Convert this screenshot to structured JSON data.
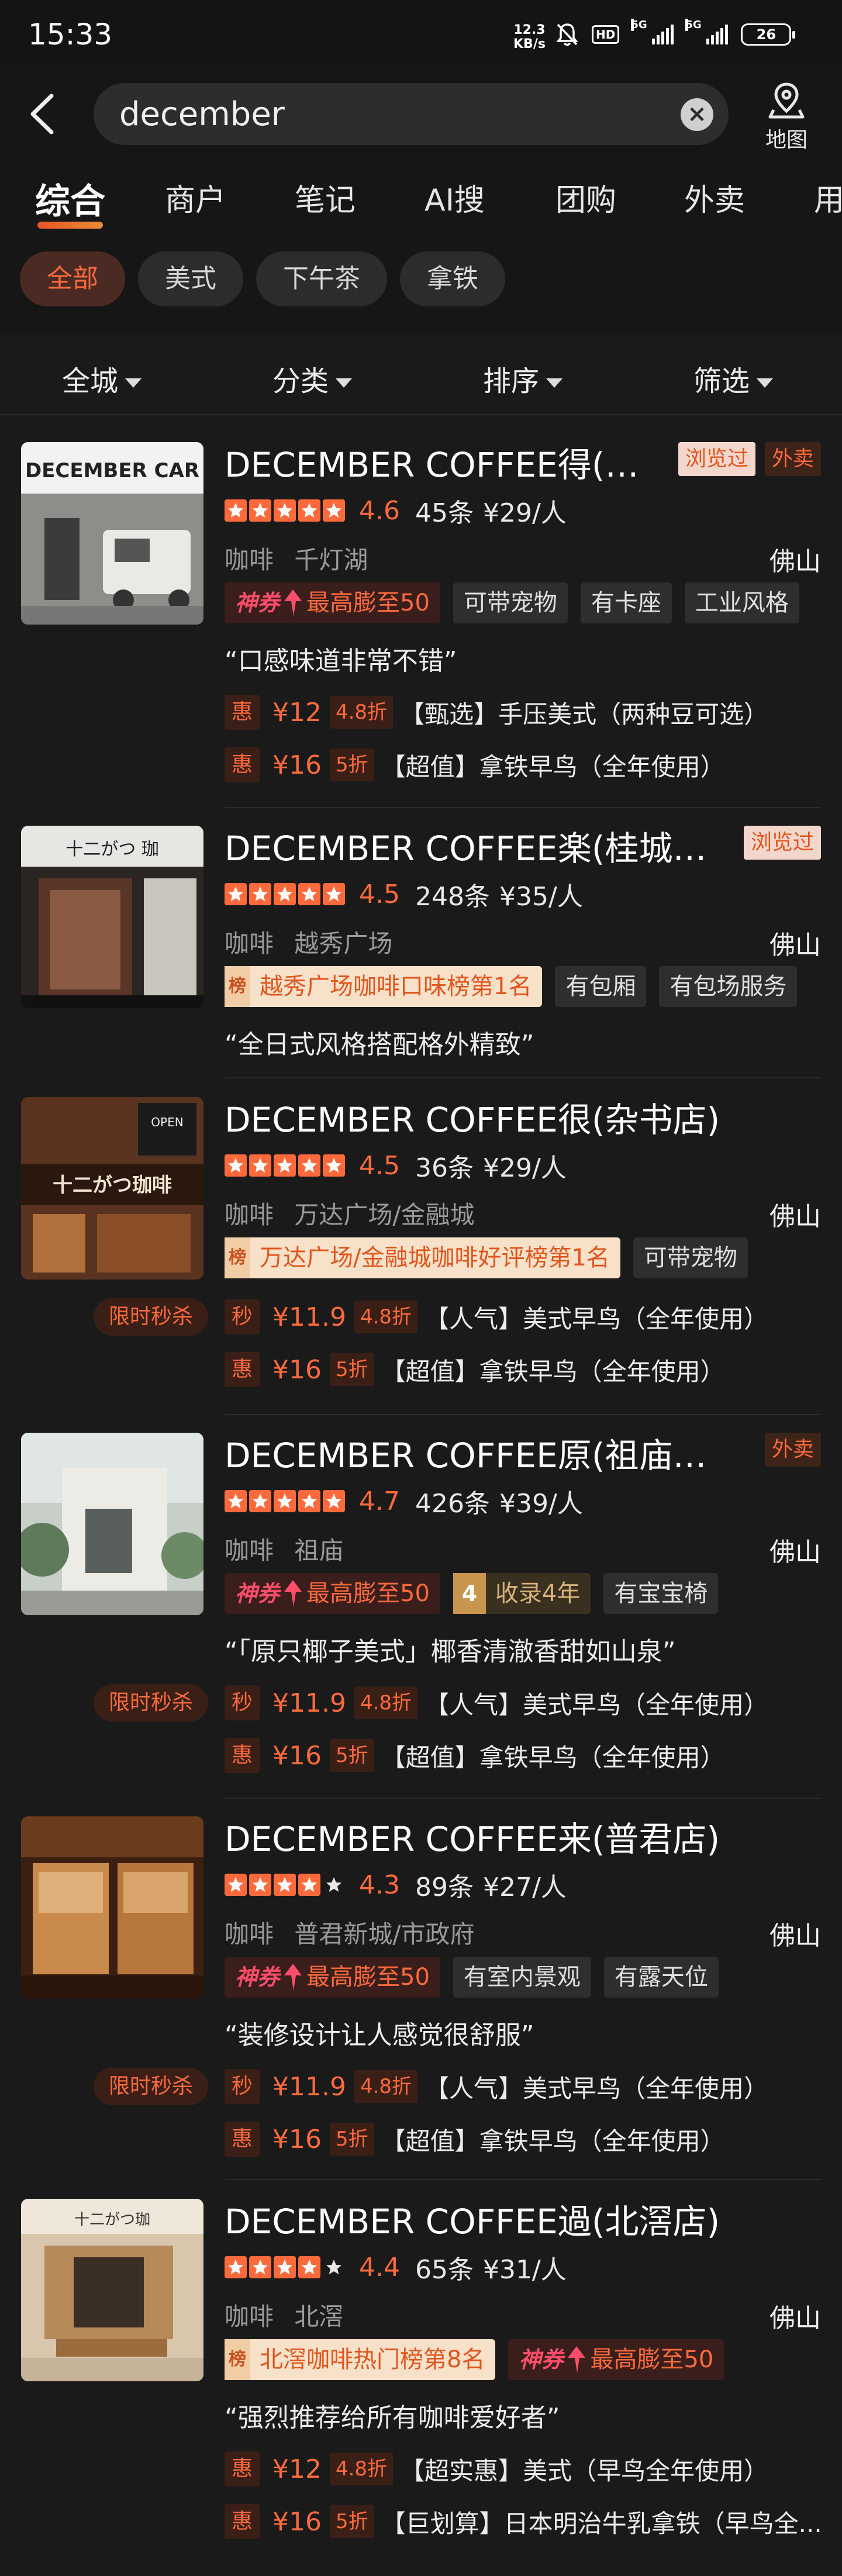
{
  "status": {
    "time": "15:33",
    "speed_value": "12.3",
    "speed_unit": "KB/s",
    "hd": "HD",
    "net1": "5G",
    "net2": "5G",
    "battery": "26"
  },
  "search": {
    "query": "december",
    "map_label": "地图"
  },
  "tabs": [
    "综合",
    "商户",
    "笔记",
    "AI搜",
    "团购",
    "外卖",
    "用"
  ],
  "chips": [
    "全部",
    "美式",
    "下午茶",
    "拿铁"
  ],
  "filters": [
    "全城",
    "分类",
    "排序",
    "筛选"
  ],
  "flash_sale_label": "限时秒杀",
  "stores": [
    {
      "title": "DECEMBER COFFEE得(手...",
      "seen": "浏览过",
      "waimai": "外卖",
      "score": "4.6",
      "reviews": "45条",
      "price": "¥29/人",
      "category": "咖啡",
      "area": "千灯湖",
      "city": "佛山",
      "tags": [
        {
          "type": "pick",
          "label": "神券",
          "text": "最高膨至50"
        },
        {
          "type": "plain",
          "text": "可带宠物"
        },
        {
          "type": "plain",
          "text": "有卡座"
        },
        {
          "type": "plain",
          "text": "工业风格"
        }
      ],
      "quote": "“口感味道非常不错”",
      "deals": [
        {
          "tag": "惠",
          "price": "¥12",
          "disc": "4.8折",
          "name": "【甄选】手压美式（两种豆可选）"
        },
        {
          "tag": "惠",
          "price": "¥16",
          "disc": "5折",
          "name": "【超值】拿铁早鸟（全年使用）"
        }
      ]
    },
    {
      "title": "DECEMBER COFFEE楽(桂城桂...",
      "seen": "浏览过",
      "score": "4.5",
      "reviews": "248条",
      "price": "¥35/人",
      "category": "咖啡",
      "area": "越秀广场",
      "city": "佛山",
      "tags": [
        {
          "type": "rank",
          "icon": "榜",
          "text": "越秀广场咖啡口味榜第1名"
        },
        {
          "type": "plain",
          "text": "有包厢"
        },
        {
          "type": "plain",
          "text": "有包场服务"
        }
      ],
      "quote": "“全日式风格搭配格外精致”"
    },
    {
      "title": "DECEMBER COFFEE很(杂书店)",
      "score": "4.5",
      "reviews": "36条",
      "price": "¥29/人",
      "category": "咖啡",
      "area": "万达广场/金融城",
      "city": "佛山",
      "tags": [
        {
          "type": "rank",
          "icon": "榜",
          "text": "万达广场/金融城咖啡好评榜第1名"
        },
        {
          "type": "plain",
          "text": "可带宠物"
        }
      ],
      "deals": [
        {
          "tag": "秒",
          "price": "¥11.9",
          "disc": "4.8折",
          "name": "【人气】美式早鸟（全年使用）"
        },
        {
          "tag": "惠",
          "price": "¥16",
          "disc": "5折",
          "name": "【超值】拿铁早鸟（全年使用）"
        }
      ]
    },
    {
      "title": "DECEMBER COFFEE原(祖庙店)",
      "waimai": "外卖",
      "score": "4.7",
      "reviews": "426条",
      "price": "¥39/人",
      "category": "咖啡",
      "area": "祖庙",
      "city": "佛山",
      "tags": [
        {
          "type": "pick",
          "label": "神券",
          "text": "最高膨至50"
        },
        {
          "type": "years",
          "num": "4",
          "text": "收录4年"
        },
        {
          "type": "plain",
          "text": "有宝宝椅"
        }
      ],
      "quote": "“「原只椰子美式」椰香清澈香甜如山泉”",
      "deals": [
        {
          "tag": "秒",
          "price": "¥11.9",
          "disc": "4.8折",
          "name": "【人气】美式早鸟（全年使用）"
        },
        {
          "tag": "惠",
          "price": "¥16",
          "disc": "5折",
          "name": "【超值】拿铁早鸟（全年使用）"
        }
      ]
    },
    {
      "title": "DECEMBER COFFEE来(普君店)",
      "score": "4.3",
      "reviews": "89条",
      "price": "¥27/人",
      "category": "咖啡",
      "area": "普君新城/市政府",
      "city": "佛山",
      "tags": [
        {
          "type": "pick",
          "label": "神券",
          "text": "最高膨至50"
        },
        {
          "type": "plain",
          "text": "有室内景观"
        },
        {
          "type": "plain",
          "text": "有露天位"
        }
      ],
      "quote": "“装修设计让人感觉很舒服”",
      "deals": [
        {
          "tag": "秒",
          "price": "¥11.9",
          "disc": "4.8折",
          "name": "【人气】美式早鸟（全年使用）"
        },
        {
          "tag": "惠",
          "price": "¥16",
          "disc": "5折",
          "name": "【超值】拿铁早鸟（全年使用）"
        }
      ]
    },
    {
      "title": "DECEMBER COFFEE過(北滘店)",
      "score": "4.4",
      "reviews": "65条",
      "price": "¥31/人",
      "category": "咖啡",
      "area": "北滘",
      "city": "佛山",
      "tags": [
        {
          "type": "rank",
          "icon": "榜",
          "text": "北滘咖啡热门榜第8名"
        },
        {
          "type": "pick",
          "label": "神券",
          "text": "最高膨至50"
        }
      ],
      "quote": "“强烈推荐给所有咖啡爱好者”",
      "deals": [
        {
          "tag": "惠",
          "price": "¥12",
          "disc": "4.8折",
          "name": "【超实惠】美式（早鸟全年使用）"
        },
        {
          "tag": "惠",
          "price": "¥16",
          "disc": "5折",
          "name": "【巨划算】日本明治牛乳拿铁（早鸟全..."
        }
      ]
    }
  ],
  "thumb_text": {
    "s1": "DECEMBER CAR",
    "s2": "十二がつ 珈",
    "s3": "十二がつ珈啡",
    "s3b": "OPEN",
    "s6": "十二がつ珈"
  },
  "colors": {
    "accent": "#ff6a3d",
    "background": "#1a1a1a",
    "tag_bg": "#2e2e2e"
  }
}
